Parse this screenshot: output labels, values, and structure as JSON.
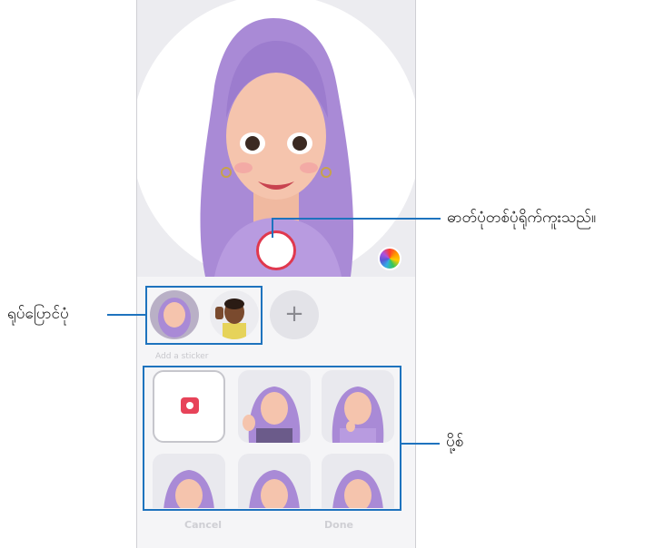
{
  "callouts": {
    "capture": "ဓာတ်ပုံတစ်ပုံရိုက်ကူးသည်။",
    "switch_avatar": "ရုပ်ပြောင်ပုံ",
    "stickers": "ပို့စ်"
  },
  "camera": {
    "add_avatar_symbol": "+",
    "section_label": "Add a sticker"
  },
  "buttons": {
    "cancel": "Cancel",
    "done": "Done"
  },
  "colors": {
    "accent_blue": "#1e73be",
    "shutter_red": "#e0384e",
    "hair_purple": "#a98ad6"
  }
}
